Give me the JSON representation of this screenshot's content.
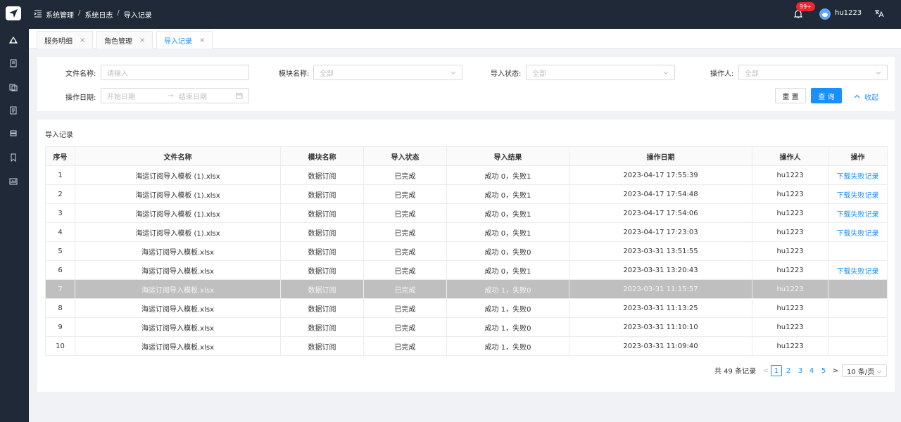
{
  "header": {
    "breadcrumb": [
      "系统管理",
      "系统日志",
      "导入记录"
    ],
    "breadcrumb_sep": "/",
    "notification_badge": "99+",
    "username": "hu1223"
  },
  "tabs": [
    {
      "label": "服务明细",
      "close": "×",
      "active": false
    },
    {
      "label": "角色管理",
      "close": "×",
      "active": false
    },
    {
      "label": "导入记录",
      "close": "×",
      "active": true
    }
  ],
  "filters": {
    "file_name_label": "文件名称:",
    "file_name_placeholder": "请输入",
    "module_label": "模块名称:",
    "module_value": "全部",
    "status_label": "导入状态:",
    "status_value": "全部",
    "operator_label": "操作人:",
    "operator_value": "全部",
    "date_label": "操作日期:",
    "date_start": "开始日期",
    "date_arrow": "→",
    "date_end": "结束日期",
    "reset_label": "重 置",
    "query_label": "查 询",
    "collapse_label": "收起"
  },
  "table": {
    "title": "导入记录",
    "columns": [
      "序号",
      "文件名称",
      "模块名称",
      "导入状态",
      "导入结果",
      "操作日期",
      "操作人",
      "操作"
    ],
    "rows": [
      {
        "no": "1",
        "file": "海运订阅导入模板 (1).xlsx",
        "module": "数据订阅",
        "status": "已完成",
        "result": "成功 0，失败1",
        "date": "2023-04-17 17:55:39",
        "operator": "hu1223",
        "action": "下载失败记录"
      },
      {
        "no": "2",
        "file": "海运订阅导入模板 (1).xlsx",
        "module": "数据订阅",
        "status": "已完成",
        "result": "成功 0，失败1",
        "date": "2023-04-17 17:54:48",
        "operator": "hu1223",
        "action": "下载失败记录"
      },
      {
        "no": "3",
        "file": "海运订阅导入模板 (1).xlsx",
        "module": "数据订阅",
        "status": "已完成",
        "result": "成功 0，失败1",
        "date": "2023-04-17 17:54:06",
        "operator": "hu1223",
        "action": "下载失败记录"
      },
      {
        "no": "4",
        "file": "海运订阅导入模板 (1).xlsx",
        "module": "数据订阅",
        "status": "已完成",
        "result": "成功 0，失败1",
        "date": "2023-04-17 17:23:03",
        "operator": "hu1223",
        "action": "下载失败记录"
      },
      {
        "no": "5",
        "file": "海运订阅导入模板.xlsx",
        "module": "数据订阅",
        "status": "已完成",
        "result": "成功 0，失败0",
        "date": "2023-03-31 13:51:55",
        "operator": "hu1223",
        "action": ""
      },
      {
        "no": "6",
        "file": "海运订阅导入模板.xlsx",
        "module": "数据订阅",
        "status": "已完成",
        "result": "成功 0，失败1",
        "date": "2023-03-31 13:20:43",
        "operator": "hu1223",
        "action": "下载失败记录"
      },
      {
        "no": "7",
        "file": "海运订阅导入模板.xlsx",
        "module": "数据订阅",
        "status": "已完成",
        "result": "成功 1，失败0",
        "date": "2023-03-31 11:15:57",
        "operator": "hu1223",
        "action": "",
        "highlight": true
      },
      {
        "no": "8",
        "file": "海运订阅导入模板.xlsx",
        "module": "数据订阅",
        "status": "已完成",
        "result": "成功 1，失败0",
        "date": "2023-03-31 11:13:25",
        "operator": "hu1223",
        "action": ""
      },
      {
        "no": "9",
        "file": "海运订阅导入模板.xlsx",
        "module": "数据订阅",
        "status": "已完成",
        "result": "成功 1，失败0",
        "date": "2023-03-31 11:10:10",
        "operator": "hu1223",
        "action": ""
      },
      {
        "no": "10",
        "file": "海运订阅导入模板.xlsx",
        "module": "数据订阅",
        "status": "已完成",
        "result": "成功 1，失败0",
        "date": "2023-03-31 11:09:40",
        "operator": "hu1223",
        "action": ""
      }
    ]
  },
  "pagination": {
    "total_text": "共 49 条记录",
    "prev": "<",
    "pages": [
      "1",
      "2",
      "3",
      "4",
      "5"
    ],
    "current": "1",
    "next": ">",
    "page_size": "10 条/页"
  },
  "colors": {
    "sidebar": "#1f2937",
    "accent": "#1890ff",
    "badge": "#f5222d"
  }
}
